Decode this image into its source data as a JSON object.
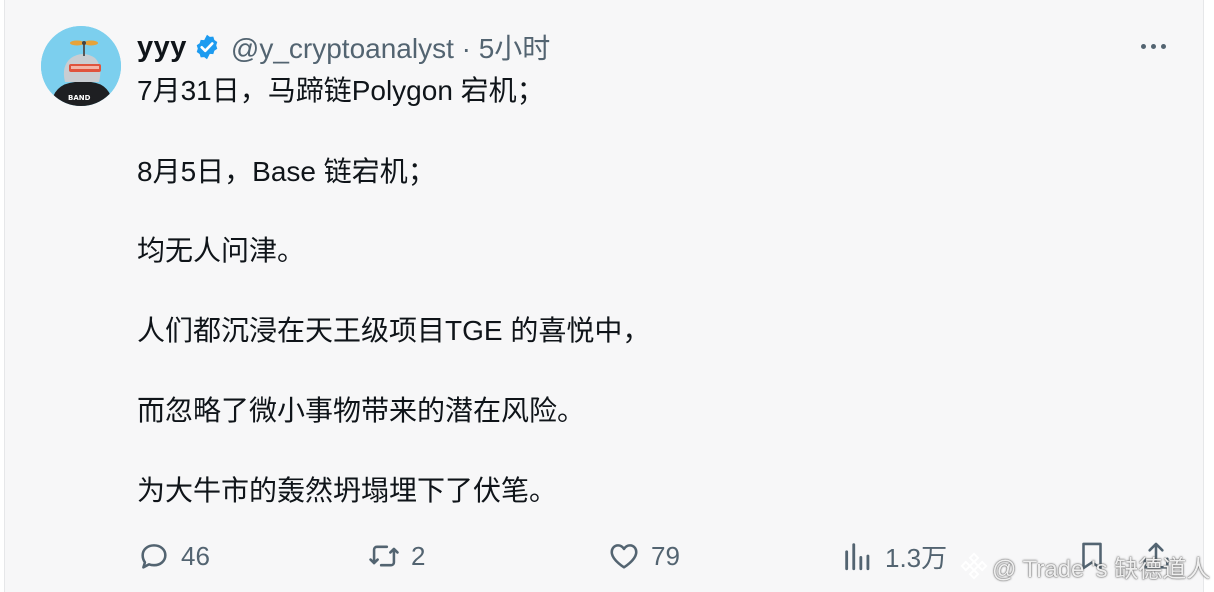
{
  "tweet": {
    "author_name": "yyy",
    "handle_time": "@y_cryptoanalyst · 5小时",
    "lines": [
      "7月31日，马蹄链Polygon 宕机；",
      "8月5日，Base 链宕机；",
      "均无人问津。",
      "人们都沉浸在天王级项目TGE 的喜悦中，",
      "而忽略了微小事物带来的潜在风险。",
      "为大牛市的轰然坍塌埋下了伏笔。"
    ]
  },
  "avatar_text": "BAND",
  "actions": {
    "replies": "46",
    "retweets": "2",
    "likes": "79",
    "views": "1.3万"
  },
  "watermark": "@ Trade 's 缺德道人",
  "colors": {
    "verified": "#1d9bf0",
    "secondary_text": "#536471",
    "avatar_bg": "#7ccfee"
  },
  "icons": [
    "verified-badge-icon",
    "more-options-icon",
    "reply-icon",
    "retweet-icon",
    "like-icon",
    "views-icon",
    "bookmark-icon",
    "share-icon",
    "binance-logo-icon"
  ]
}
